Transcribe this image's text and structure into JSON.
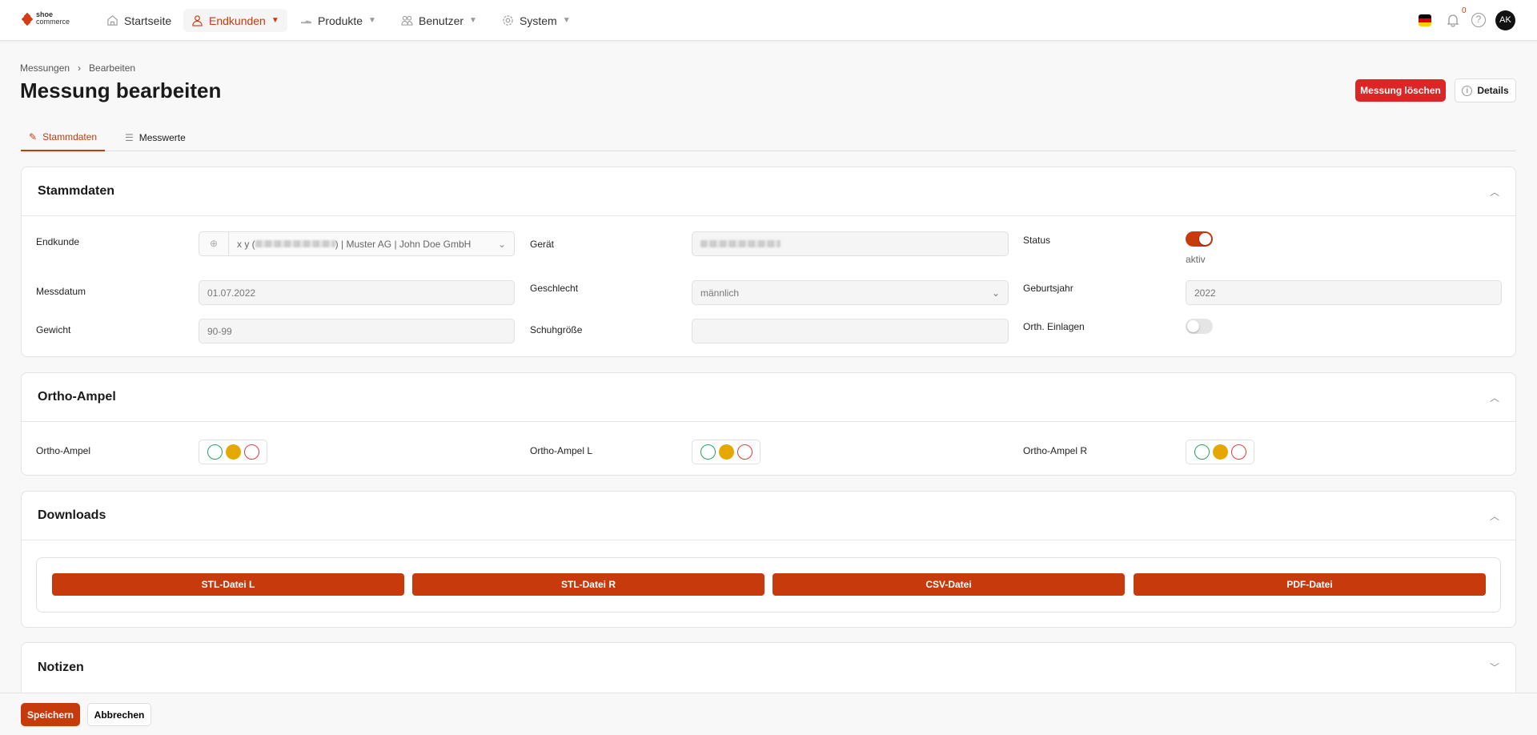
{
  "nav": {
    "logo_top": "shoe",
    "logo_bottom": "commerce",
    "items": [
      {
        "label": "Startseite"
      },
      {
        "label": "Endkunden"
      },
      {
        "label": "Produkte"
      },
      {
        "label": "Benutzer"
      },
      {
        "label": "System"
      }
    ],
    "notifications": "0",
    "avatar": "AK",
    "help": "?"
  },
  "breadcrumb": [
    "Messungen",
    "Bearbeiten"
  ],
  "title": "Messung bearbeiten",
  "actions": {
    "delete": "Messung löschen",
    "details": "Details"
  },
  "tabs": [
    "Stammdaten",
    "Messwerte"
  ],
  "stammdaten": {
    "title": "Stammdaten",
    "endkunde_label": "Endkunde",
    "endkunde_prefix": "x y (",
    "endkunde_suffix": ") | Muster AG | John Doe GmbH",
    "geraet_label": "Gerät",
    "status_label": "Status",
    "status_value": "aktiv",
    "messdatum_label": "Messdatum",
    "messdatum": "01.07.2022",
    "geschlecht_label": "Geschlecht",
    "geschlecht": "männlich",
    "geburtsjahr_label": "Geburtsjahr",
    "geburtsjahr": "2022",
    "gewicht_label": "Gewicht",
    "gewicht": "90-99",
    "schuhgroesse_label": "Schuhgröße",
    "schuhgroesse": "",
    "einlagen_label": "Orth. Einlagen",
    "status_on": true,
    "einlagen_on": false
  },
  "ortho": {
    "title": "Ortho-Ampel",
    "labels": [
      "Ortho-Ampel",
      "Ortho-Ampel L",
      "Ortho-Ampel R"
    ],
    "colors": {
      "green": "#22a45d",
      "yellow": "#e5a800",
      "red": "#e23b3b"
    }
  },
  "downloads": {
    "title": "Downloads",
    "buttons": [
      "STL-Datei L",
      "STL-Datei R",
      "CSV-Datei",
      "PDF-Datei"
    ]
  },
  "notizen": {
    "title": "Notizen"
  },
  "footer": {
    "save": "Speichern",
    "cancel": "Abbrechen"
  },
  "accent": "#c73a0c"
}
